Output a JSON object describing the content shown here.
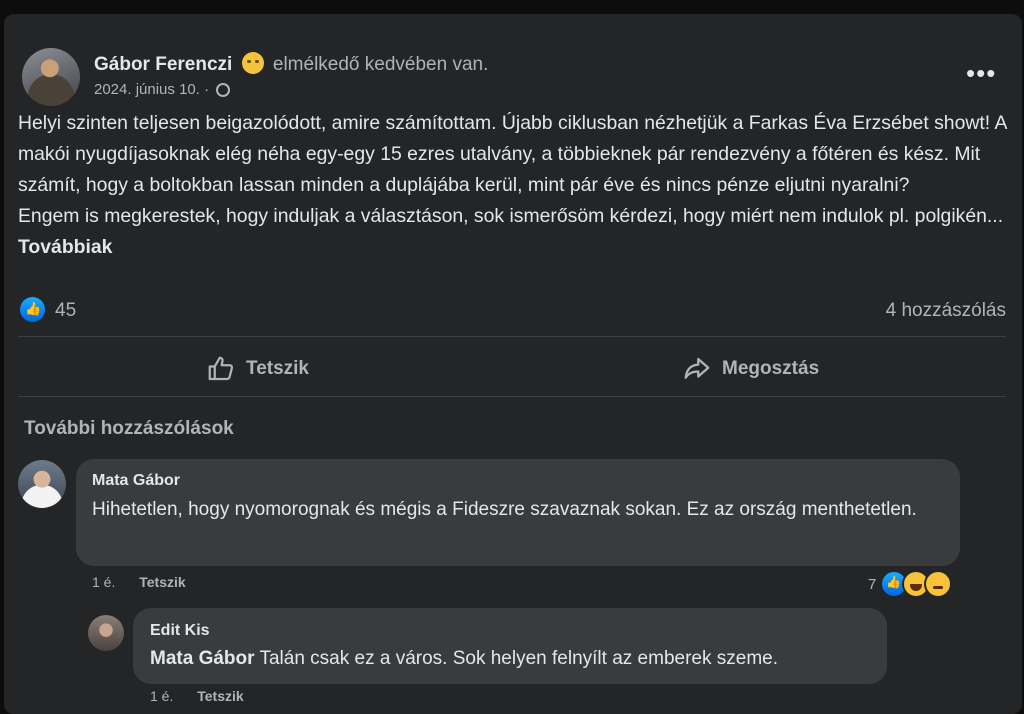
{
  "post": {
    "author": "Gábor Ferenczi",
    "feeling": "elmélkedő kedvében van.",
    "date": "2024. június 10.",
    "separator": "·",
    "more_menu": "•••",
    "text": "Helyi szinten teljesen beigazolódott, amire számítottam. Újabb ciklusban nézhetjük a Farkas Éva Erzsébet showt! A makói nyugdíjasoknak elég néha egy-egy 15 ezres utalvány,  a többieknek pár rendezvény a főtéren és kész. Mit számít, hogy a boltokban lassan minden  a duplájába kerül, mint pár éve és nincs pénze eljutni nyaralni?\nEngem is megkerestek, hogy induljak a választáson, sok ismerősöm kérdezi, hogy miért nem indulok pl. polgikén...",
    "see_more": "Továbbiak",
    "like_count": "45",
    "comment_count": "4 hozzászólás",
    "actions": {
      "like": "Tetszik",
      "share": "Megosztás"
    },
    "more_comments": "További hozzászólások"
  },
  "comments": [
    {
      "name": "Mata Gábor",
      "text": "Hihetetlen, hogy nyomorognak és mégis a Fideszre szavaznak sokan. Ez az ország menthetetlen.",
      "time": "1 é.",
      "like_label": "Tetszik",
      "reaction_count": "7",
      "reactions": [
        "like-icon",
        "haha-icon",
        "sad-icon"
      ]
    },
    {
      "name": "Edit Kis",
      "mention": "Mata Gábor",
      "text": " Talán csak ez a város. Sok helyen felnyílt az emberek szeme.",
      "time": "1 é.",
      "like_label": "Tetszik"
    }
  ],
  "colors": {
    "card": "#242526",
    "bubble": "#3a3b3c",
    "like_blue": "#0866ff"
  }
}
